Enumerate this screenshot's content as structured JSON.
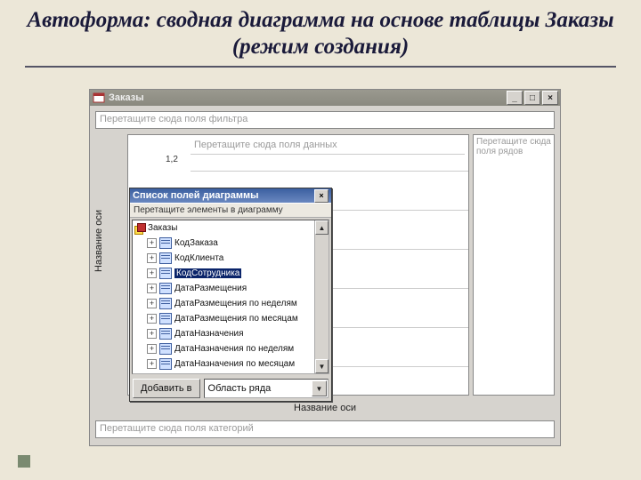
{
  "slide": {
    "title": "Автоформа: сводная диаграмма на основе таблицы Заказы (режим создания)"
  },
  "window": {
    "title": "Заказы",
    "filter_placeholder": "Перетащите сюда поля фильтра",
    "data_placeholder": "Перетащите сюда поля данных",
    "rows_placeholder": "Перетащите сюда поля рядов",
    "cat_placeholder": "Перетащите сюда поля категорий",
    "axis_label": "Название оси",
    "ytick": "1,2"
  },
  "fieldlist": {
    "title": "Список полей диаграммы",
    "hint": "Перетащите элементы в диаграмму",
    "root": "Заказы",
    "items": [
      {
        "label": "КодЗаказа"
      },
      {
        "label": "КодКлиента"
      },
      {
        "label": "КодСотрудника",
        "selected": true
      },
      {
        "label": "ДатаРазмещения"
      },
      {
        "label": "ДатаРазмещения по неделям"
      },
      {
        "label": "ДатаРазмещения по месяцам"
      },
      {
        "label": "ДатаНазначения"
      },
      {
        "label": "ДатаНазначения по неделям"
      },
      {
        "label": "ДатаНазначения по месяцам"
      }
    ],
    "add_button": "Добавить в",
    "combo": "Область ряда"
  }
}
